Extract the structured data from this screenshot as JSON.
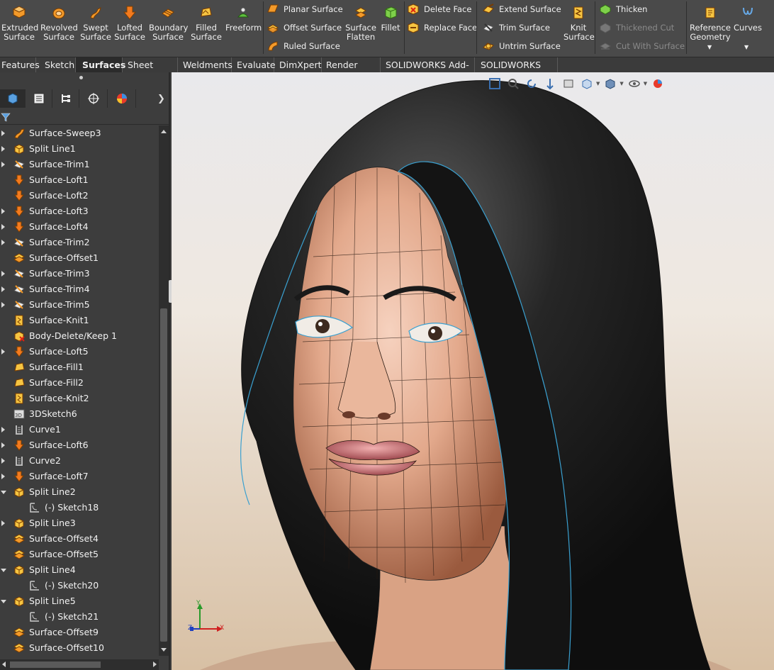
{
  "ribbon": {
    "big_buttons": [
      {
        "id": "extruded",
        "label1": "Extruded",
        "label2": "Surface",
        "icon": "extruded-surface-icon"
      },
      {
        "id": "revolved",
        "label1": "Revolved",
        "label2": "Surface",
        "icon": "revolved-surface-icon"
      },
      {
        "id": "swept",
        "label1": "Swept",
        "label2": "Surface",
        "icon": "swept-surface-icon"
      },
      {
        "id": "lofted",
        "label1": "Lofted",
        "label2": "Surface",
        "icon": "lofted-surface-icon"
      },
      {
        "id": "boundary",
        "label1": "Boundary",
        "label2": "Surface",
        "icon": "boundary-surface-icon"
      },
      {
        "id": "filled",
        "label1": "Filled",
        "label2": "Surface",
        "icon": "filled-surface-icon"
      },
      {
        "id": "freeform",
        "label1": "Freeform",
        "label2": "",
        "icon": "freeform-icon"
      }
    ],
    "col1": [
      "Planar Surface",
      "Offset Surface",
      "Ruled Surface"
    ],
    "flatten": {
      "label1": "Surface",
      "label2": "Flatten"
    },
    "fillet": {
      "label1": "Fillet"
    },
    "col2": [
      "Delete Face",
      "Replace Face"
    ],
    "col3": [
      "Extend Surface",
      "Trim Surface",
      "Untrim Surface"
    ],
    "knit": {
      "label1": "Knit",
      "label2": "Surface"
    },
    "col4": [
      "Thicken",
      "Thickened Cut",
      "Cut With Surface"
    ],
    "refgeo": {
      "label1": "Reference",
      "label2": "Geometry"
    },
    "curves": {
      "label1": "Curves"
    }
  },
  "tabs": [
    "Features",
    "Sketch",
    "Surfaces",
    "Sheet Metal",
    "Weldments",
    "Evaluate",
    "DimXpert",
    "Render Tools",
    "SOLIDWORKS Add-Ins",
    "SOLIDWORKS MBD"
  ],
  "active_tab": "Surfaces",
  "tree": [
    {
      "label": "Surface-Sweep3",
      "icon": "sweep",
      "arrow": "closed",
      "indent": 0
    },
    {
      "label": "Split Line1",
      "icon": "split",
      "arrow": "closed",
      "indent": 0
    },
    {
      "label": "Surface-Trim1",
      "icon": "trim",
      "arrow": "closed",
      "indent": 0
    },
    {
      "label": "Surface-Loft1",
      "icon": "loft",
      "arrow": "none",
      "indent": 0
    },
    {
      "label": "Surface-Loft2",
      "icon": "loft",
      "arrow": "none",
      "indent": 0
    },
    {
      "label": "Surface-Loft3",
      "icon": "loft",
      "arrow": "closed",
      "indent": 0
    },
    {
      "label": "Surface-Loft4",
      "icon": "loft",
      "arrow": "closed",
      "indent": 0
    },
    {
      "label": "Surface-Trim2",
      "icon": "trim",
      "arrow": "closed",
      "indent": 0
    },
    {
      "label": "Surface-Offset1",
      "icon": "offset",
      "arrow": "none",
      "indent": 0
    },
    {
      "label": "Surface-Trim3",
      "icon": "trim",
      "arrow": "closed",
      "indent": 0
    },
    {
      "label": "Surface-Trim4",
      "icon": "trim",
      "arrow": "closed",
      "indent": 0
    },
    {
      "label": "Surface-Trim5",
      "icon": "trim",
      "arrow": "closed",
      "indent": 0
    },
    {
      "label": "Surface-Knit1",
      "icon": "knit",
      "arrow": "none",
      "indent": 0
    },
    {
      "label": "Body-Delete/Keep 1",
      "icon": "delete",
      "arrow": "none",
      "indent": 0
    },
    {
      "label": "Surface-Loft5",
      "icon": "loft",
      "arrow": "closed",
      "indent": 0
    },
    {
      "label": "Surface-Fill1",
      "icon": "fill",
      "arrow": "none",
      "indent": 0
    },
    {
      "label": "Surface-Fill2",
      "icon": "fill",
      "arrow": "none",
      "indent": 0
    },
    {
      "label": "Surface-Knit2",
      "icon": "knit",
      "arrow": "none",
      "indent": 0
    },
    {
      "label": "3DSketch6",
      "icon": "sketch3d",
      "arrow": "none",
      "indent": 0
    },
    {
      "label": "Curve1",
      "icon": "curve",
      "arrow": "closed",
      "indent": 0
    },
    {
      "label": "Surface-Loft6",
      "icon": "loft",
      "arrow": "closed",
      "indent": 0
    },
    {
      "label": "Curve2",
      "icon": "curve",
      "arrow": "closed",
      "indent": 0
    },
    {
      "label": "Surface-Loft7",
      "icon": "loft",
      "arrow": "closed",
      "indent": 0
    },
    {
      "label": "Split Line2",
      "icon": "split",
      "arrow": "open",
      "indent": 0
    },
    {
      "label": "(-) Sketch18",
      "icon": "sketch",
      "arrow": "none",
      "indent": 1
    },
    {
      "label": "Split Line3",
      "icon": "split",
      "arrow": "closed",
      "indent": 0
    },
    {
      "label": "Surface-Offset4",
      "icon": "offset",
      "arrow": "none",
      "indent": 0
    },
    {
      "label": "Surface-Offset5",
      "icon": "offset",
      "arrow": "none",
      "indent": 0
    },
    {
      "label": "Split Line4",
      "icon": "split",
      "arrow": "open",
      "indent": 0
    },
    {
      "label": "(-) Sketch20",
      "icon": "sketch",
      "arrow": "none",
      "indent": 1
    },
    {
      "label": "Split Line5",
      "icon": "split",
      "arrow": "open",
      "indent": 0
    },
    {
      "label": "(-) Sketch21",
      "icon": "sketch",
      "arrow": "none",
      "indent": 1
    },
    {
      "label": "Surface-Offset9",
      "icon": "offset",
      "arrow": "none",
      "indent": 0
    },
    {
      "label": "Surface-Offset10",
      "icon": "offset",
      "arrow": "none",
      "indent": 0
    }
  ],
  "triad": {
    "x": "X",
    "y": "Y",
    "z": "Z"
  },
  "colors": {
    "accent_orange": "#f28c1e",
    "ribbon_bg": "#4a4a4a",
    "panel_bg": "#3d3d3d",
    "hair": "#1b1b1b",
    "skin": "#e9b59a"
  }
}
